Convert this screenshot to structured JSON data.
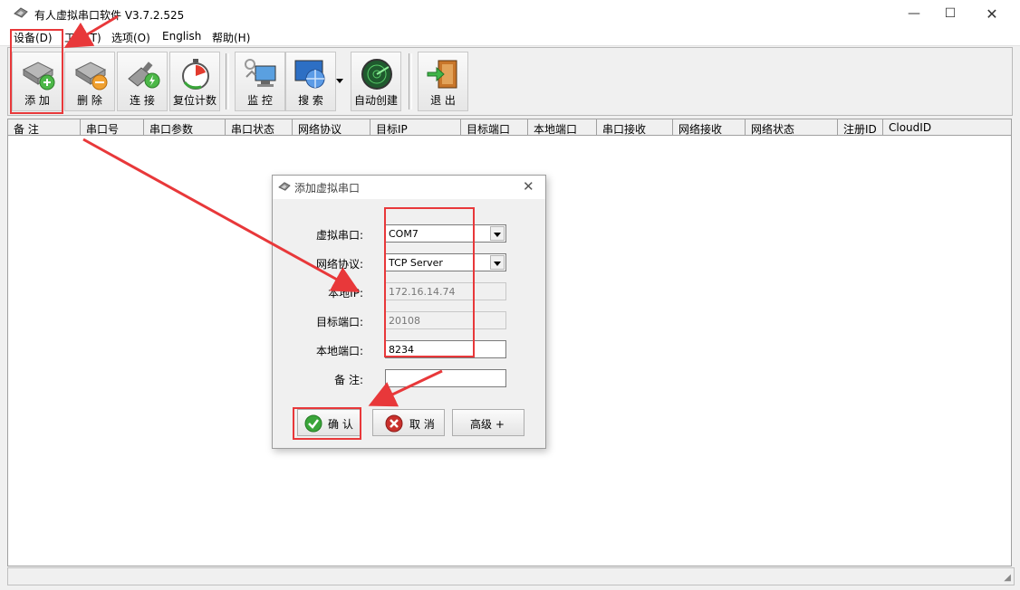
{
  "window": {
    "title": "有人虚拟串口软件 V3.7.2.525"
  },
  "menu": [
    {
      "label": "设备(D)",
      "name": "menu-device"
    },
    {
      "label": "工具(T)",
      "name": "menu-tools"
    },
    {
      "label": "选项(O)",
      "name": "menu-options"
    },
    {
      "label": "English",
      "name": "menu-english"
    },
    {
      "label": "帮助(H)",
      "name": "menu-help"
    }
  ],
  "toolbar": {
    "add": "添 加",
    "delete": "删 除",
    "connect": "连 接",
    "reset_count": "复位计数",
    "monitor": "监 控",
    "search": "搜 索",
    "auto_create": "自动创建",
    "exit": "退 出"
  },
  "table": {
    "columns": [
      "备 注",
      "串口号",
      "串口参数",
      "串口状态",
      "网络协议",
      "目标IP",
      "目标端口",
      "本地端口",
      "串口接收",
      "网络接收",
      "网络状态",
      "注册ID",
      "CloudID"
    ]
  },
  "dialog": {
    "title": "添加虚拟串口",
    "fields": {
      "virtual_port": {
        "label": "虚拟串口:",
        "value": "COM7"
      },
      "protocol": {
        "label": "网络协议:",
        "value": "TCP Server"
      },
      "local_ip": {
        "label": "本地IP:",
        "value": "172.16.14.74"
      },
      "target_port": {
        "label": "目标端口:",
        "value": "20108"
      },
      "local_port": {
        "label": "本地端口:",
        "value": "8234"
      },
      "remark": {
        "label": "备  注:",
        "value": ""
      }
    },
    "buttons": {
      "ok": "确 认",
      "cancel": "取 消",
      "advanced": "高级 +"
    }
  },
  "colors": {
    "annotation": "#e8383a",
    "ok_icon": "#3aa53a",
    "cancel_icon": "#c9302c"
  }
}
